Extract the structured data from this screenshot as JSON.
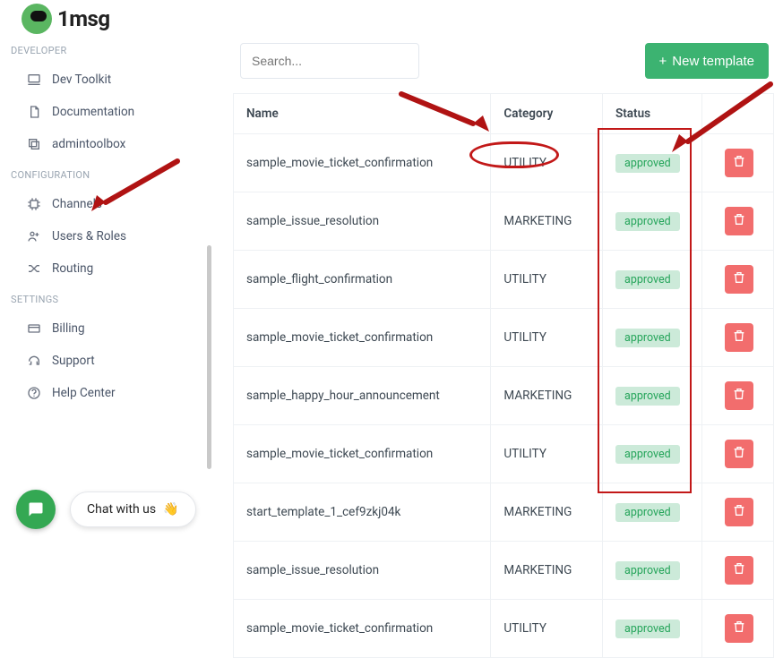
{
  "brand": {
    "text": "1msg"
  },
  "sidebar": {
    "groups": [
      {
        "label": "DEVELOPER",
        "items": [
          {
            "icon": "laptop-icon",
            "label": "Dev Toolkit"
          },
          {
            "icon": "document-icon",
            "label": "Documentation"
          },
          {
            "icon": "copy-icon",
            "label": "admintoolbox"
          }
        ]
      },
      {
        "label": "CONFIGURATION",
        "items": [
          {
            "icon": "chip-icon",
            "label": "Channels"
          },
          {
            "icon": "users-icon",
            "label": "Users & Roles"
          },
          {
            "icon": "shuffle-icon",
            "label": "Routing"
          }
        ]
      },
      {
        "label": "SETTINGS",
        "items": [
          {
            "icon": "card-icon",
            "label": "Billing"
          },
          {
            "icon": "headset-icon",
            "label": "Support"
          },
          {
            "icon": "help-icon",
            "label": "Help Center"
          }
        ]
      }
    ]
  },
  "toolbar": {
    "search_placeholder": "Search...",
    "new_button": "New template"
  },
  "table": {
    "headers": {
      "name": "Name",
      "category": "Category",
      "status": "Status"
    },
    "rows": [
      {
        "name": "sample_movie_ticket_confirmation",
        "category": "UTILITY",
        "status": "approved"
      },
      {
        "name": "sample_issue_resolution",
        "category": "MARKETING",
        "status": "approved"
      },
      {
        "name": "sample_flight_confirmation",
        "category": "UTILITY",
        "status": "approved"
      },
      {
        "name": "sample_movie_ticket_confirmation",
        "category": "UTILITY",
        "status": "approved"
      },
      {
        "name": "sample_happy_hour_announcement",
        "category": "MARKETING",
        "status": "approved"
      },
      {
        "name": "sample_movie_ticket_confirmation",
        "category": "UTILITY",
        "status": "approved"
      },
      {
        "name": "start_template_1_cef9zkj04k",
        "category": "MARKETING",
        "status": "approved"
      },
      {
        "name": "sample_issue_resolution",
        "category": "MARKETING",
        "status": "approved"
      },
      {
        "name": "sample_movie_ticket_confirmation",
        "category": "UTILITY",
        "status": "approved"
      }
    ]
  },
  "chat": {
    "pill_text": "Chat with us",
    "emoji": "👋"
  }
}
